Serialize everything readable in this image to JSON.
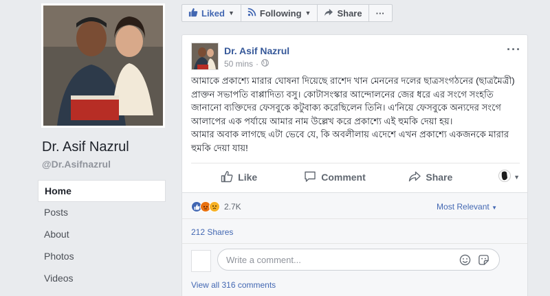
{
  "profile": {
    "name": "Dr. Asif Nazrul",
    "handle": "@Dr.Asifnazrul",
    "nav": [
      {
        "label": "Home",
        "active": true
      },
      {
        "label": "Posts"
      },
      {
        "label": "About"
      },
      {
        "label": "Photos"
      },
      {
        "label": "Videos"
      }
    ]
  },
  "action_bar": {
    "liked_label": "Liked",
    "following_label": "Following",
    "share_label": "Share",
    "more_label": "···"
  },
  "post": {
    "author": "Dr. Asif Nazrul",
    "time": "50 mins",
    "time_sep": "·",
    "text_1": "আমাকে প্রকাশ্যে মারার ঘোষনা দিয়েছে রাশেদ খান মেননের দলের ছাত্রসংগঠনের (ছাত্রমৈত্রী) প্রাক্তন সভাপতি বাপ্পাদিত্য বসু। কোটাসংস্কার আন্দোলনের জের ধরে এর সংগে সংহতি জানানো ব্যক্তিদের ফেসবুকে কটুবাক্য করেছিলেন তিনি। এ'নিয়ে ফেসবুকে অন্যদের সংগে আলাপের এক পর্যায়ে আমার নাম উল্লেখ করে প্রকাশ্যে এই হুমকি দেয়া হয়।",
    "text_2": "আমার অবাক লাগছে এটা ভেবে যে, কি অবলীলায় এদেশে এখন প্রকাশ্যে একজনকে মারার হুমকি দেয়া যায়!",
    "like_label": "Like",
    "comment_label": "Comment",
    "share_label": "Share",
    "reaction_count": "2.7K",
    "most_relevant": "Most Relevant",
    "shares": "212 Shares",
    "comment_placeholder": "Write a comment...",
    "view_all": "View all 316 comments"
  },
  "colors": {
    "link": "#365899",
    "accent": "#4267b2",
    "background": "#e9ebee"
  }
}
